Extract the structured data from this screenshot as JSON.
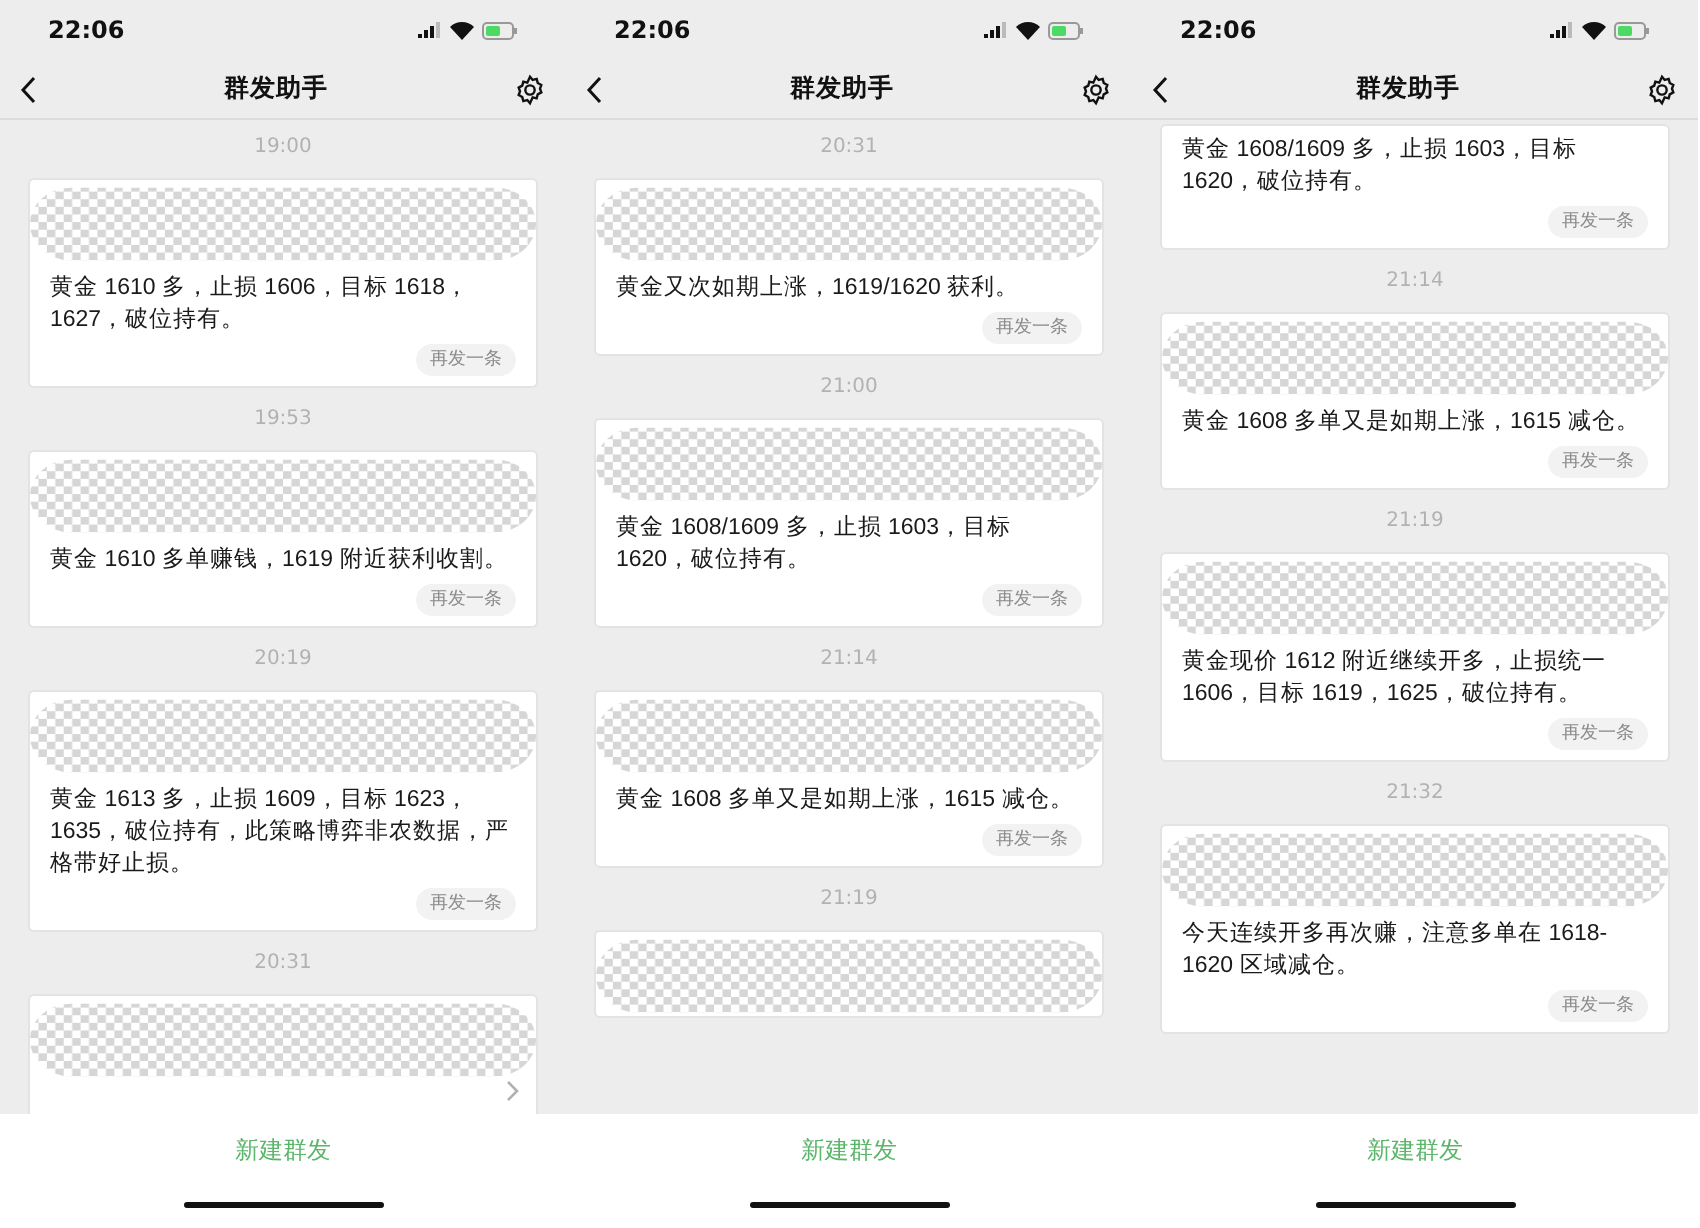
{
  "phones": [
    {
      "status_time": "22:06",
      "title": "群发助手",
      "footer_button": "新建群发",
      "items": [
        {
          "kind": "time",
          "text": "19:00"
        },
        {
          "kind": "card",
          "redacted_header": true,
          "text": "黄金 1610 多，止损 1606，目标 1618，1627，破位持有。",
          "resend": "再发一条"
        },
        {
          "kind": "time",
          "text": "19:53"
        },
        {
          "kind": "card",
          "redacted_header": true,
          "text": "黄金 1610 多单赚钱，1619 附近获利收割。",
          "resend": "再发一条"
        },
        {
          "kind": "time",
          "text": "20:19"
        },
        {
          "kind": "card",
          "redacted_header": true,
          "text": "黄金 1613 多，止损 1609，目标 1623，1635，破位持有，此策略博弈非农数据，严格带好止损。",
          "resend": "再发一条"
        },
        {
          "kind": "time",
          "text": "20:31"
        },
        {
          "kind": "collapsed",
          "redacted_header": true
        }
      ]
    },
    {
      "status_time": "22:06",
      "title": "群发助手",
      "footer_button": "新建群发",
      "items": [
        {
          "kind": "time",
          "text": "20:31"
        },
        {
          "kind": "card",
          "redacted_header": true,
          "text": "黄金又次如期上涨，1619/1620 获利。",
          "resend": "再发一条"
        },
        {
          "kind": "time",
          "text": "21:00"
        },
        {
          "kind": "card",
          "redacted_header": true,
          "text": "黄金 1608/1609 多，止损 1603，目标 1620，破位持有。",
          "resend": "再发一条"
        },
        {
          "kind": "time",
          "text": "21:14"
        },
        {
          "kind": "card",
          "redacted_header": true,
          "text": "黄金 1608 多单又是如期上涨，1615 减仓。",
          "resend": "再发一条"
        },
        {
          "kind": "time",
          "text": "21:19"
        },
        {
          "kind": "card",
          "redacted_header": true
        }
      ]
    },
    {
      "status_time": "22:06",
      "title": "群发助手",
      "footer_button": "新建群发",
      "items": [
        {
          "kind": "card",
          "redacted_header": false,
          "text": "黄金 1608/1609 多，止损 1603，目标 1620，破位持有。",
          "resend": "再发一条"
        },
        {
          "kind": "time",
          "text": "21:14"
        },
        {
          "kind": "card",
          "redacted_header": true,
          "text": "黄金 1608 多单又是如期上涨，1615 减仓。",
          "resend": "再发一条"
        },
        {
          "kind": "time",
          "text": "21:19"
        },
        {
          "kind": "card",
          "redacted_header": true,
          "text": "黄金现价 1612 附近继续开多，止损统一 1606，目标 1619，1625，破位持有。",
          "resend": "再发一条"
        },
        {
          "kind": "time",
          "text": "21:32"
        },
        {
          "kind": "card",
          "redacted_header": true,
          "text": "今天连续开多再次赚，注意多单在 1618-1620 区域减仓。",
          "resend": "再发一条"
        }
      ]
    }
  ]
}
